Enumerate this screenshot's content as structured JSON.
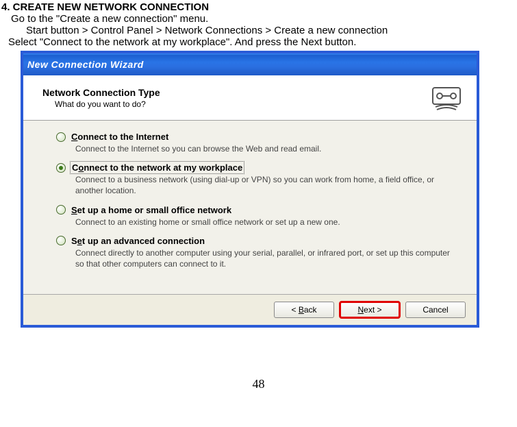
{
  "doc": {
    "heading": "4. CREATE NEW NETWORK CONNECTION",
    "line1": "Go to the \"Create a new connection\" menu.",
    "line2": "Start button > Control Panel > Network Connections > Create a new connection",
    "line3": "Select \"Connect to the network at my workplace\". And press the Next button."
  },
  "window": {
    "title": "New Connection Wizard",
    "header_title": "Network Connection Type",
    "header_subtitle": "What do you want to do?"
  },
  "options": [
    {
      "label_pre": "",
      "label_u": "C",
      "label_post": "onnect to the Internet",
      "desc": "Connect to the Internet so you can browse the Web and read email.",
      "checked": false
    },
    {
      "label_pre": "C",
      "label_u": "o",
      "label_post": "nnect to the network at my workplace",
      "desc": "Connect to a business network (using dial-up or VPN) so you can work from home, a field office, or another location.",
      "checked": true
    },
    {
      "label_pre": "",
      "label_u": "S",
      "label_post": "et up a home or small office network",
      "desc": "Connect to an existing home or small office network or set up a new one.",
      "checked": false
    },
    {
      "label_pre": "S",
      "label_u": "e",
      "label_post": "t up an advanced connection",
      "desc": "Connect directly to another computer using your serial, parallel, or infrared port, or set up this computer so that other computers can connect to it.",
      "checked": false
    }
  ],
  "buttons": {
    "back_pre": "< ",
    "back_u": "B",
    "back_post": "ack",
    "next_u": "N",
    "next_post": "ext >",
    "cancel": "Cancel"
  },
  "page_number": "48"
}
